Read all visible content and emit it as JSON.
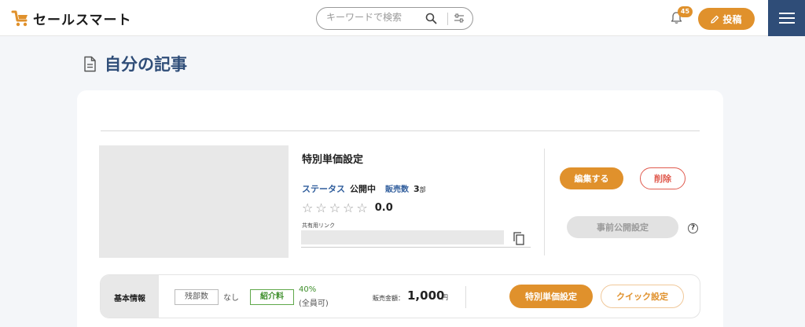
{
  "header": {
    "brand": "セールスマート",
    "search_placeholder": "キーワードで検索",
    "notification_count": "45",
    "post_label": "投稿"
  },
  "page": {
    "title": "自分の記事"
  },
  "article": {
    "title": "特別単価設定",
    "status_label": "ステータス",
    "status_value": "公開中",
    "sales_label": "販売数",
    "sales_count": "3",
    "sales_unit": "部",
    "rating": "0.0",
    "rating_stars": 0,
    "share_label": "共有用リンク",
    "edit_label": "編集する",
    "delete_label": "削除",
    "prepublish_label": "事前公開設定",
    "help_symbol": "?"
  },
  "info": {
    "section_label": "基本情報",
    "remain_label": "残部数",
    "remain_value": "なし",
    "fee_label": "紹介料",
    "fee_percent": "40%",
    "fee_note": "(全員可)",
    "price_label": "販売金額：",
    "price_value": "1,000",
    "price_unit": "円",
    "special_price_label": "特別単価設定",
    "quick_settings_label": "クイック設定"
  },
  "colors": {
    "accent": "#e0912c",
    "navy": "#2f4d78",
    "danger": "#e05a4e",
    "green": "#3f8f2c"
  },
  "icons": {
    "logo": "shopping-cart-logo-icon",
    "search": "search-icon",
    "filter": "filter-sliders-icon",
    "bell": "bell-icon",
    "pencil": "pencil-icon",
    "menu": "hamburger-menu-icon",
    "document": "document-icon",
    "copy": "copy-icon",
    "star": "star-outline-icon",
    "help": "help-circle-icon"
  }
}
